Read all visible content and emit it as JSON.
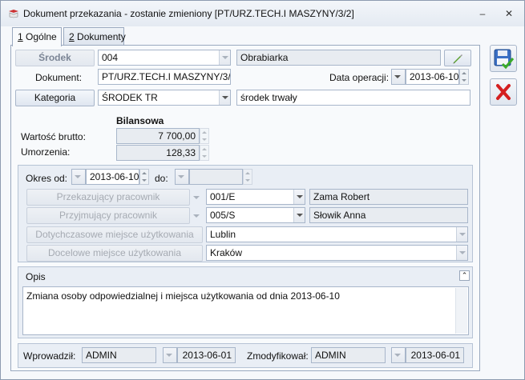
{
  "window": {
    "title": "Dokument przekazania - zostanie zmieniony [PT/URZ.TECH.I MASZYNY/3/2]"
  },
  "tabs": [
    {
      "label": "Ogólne",
      "key": "1"
    },
    {
      "label": "Dokumenty",
      "key": "2"
    }
  ],
  "srodek": {
    "button": "Środek",
    "code": "004",
    "name": "Obrabiarka"
  },
  "dokument": {
    "label": "Dokument:",
    "value": "PT/URZ.TECH.I MASZYNY/3/2"
  },
  "data_operacji": {
    "label": "Data operacji:",
    "value": "2013-06-10"
  },
  "kategoria": {
    "button": "Kategoria",
    "code": "ŚRODEK TR",
    "name": "środek trwały"
  },
  "bilansowa": {
    "header": "Bilansowa",
    "wartosc_label": "Wartość brutto:",
    "wartosc_value": "7 700,00",
    "umorzenia_label": "Umorzenia:",
    "umorzenia_value": "128,33"
  },
  "okres": {
    "od_label": "Okres od:",
    "od_value": "2013-06-10",
    "do_label": "do:",
    "do_value": ""
  },
  "pracownicy": {
    "przekazujacy_btn": "Przekazujący pracownik",
    "przekazujacy_code": "001/E",
    "przekazujacy_name": "Zama Robert",
    "przyjmujacy_btn": "Przyjmujący pracownik",
    "przyjmujacy_code": "005/S",
    "przyjmujacy_name": "Słowik Anna"
  },
  "miejsca": {
    "dotychczasowe_btn": "Dotychczasowe miejsce użytkowania",
    "dotychczasowe_value": "Lublin",
    "docelowe_btn": "Docelowe miejsce użytkowania",
    "docelowe_value": "Kraków"
  },
  "opis": {
    "header": "Opis",
    "text": "Zmiana osoby odpowiedzialnej i miejsca użytkowania od dnia 2013-06-10"
  },
  "footer": {
    "wprowadzil_label": "Wprowadził:",
    "wprowadzil_user": "ADMIN",
    "wprowadzil_date": "2013-06-01",
    "zmodyfikowal_label": "Zmodyfikował:",
    "zmodyfikowal_user": "ADMIN",
    "zmodyfikowal_date": "2013-06-01"
  },
  "colors": {
    "accent": "#2a6fd6",
    "delete": "#d42020"
  }
}
